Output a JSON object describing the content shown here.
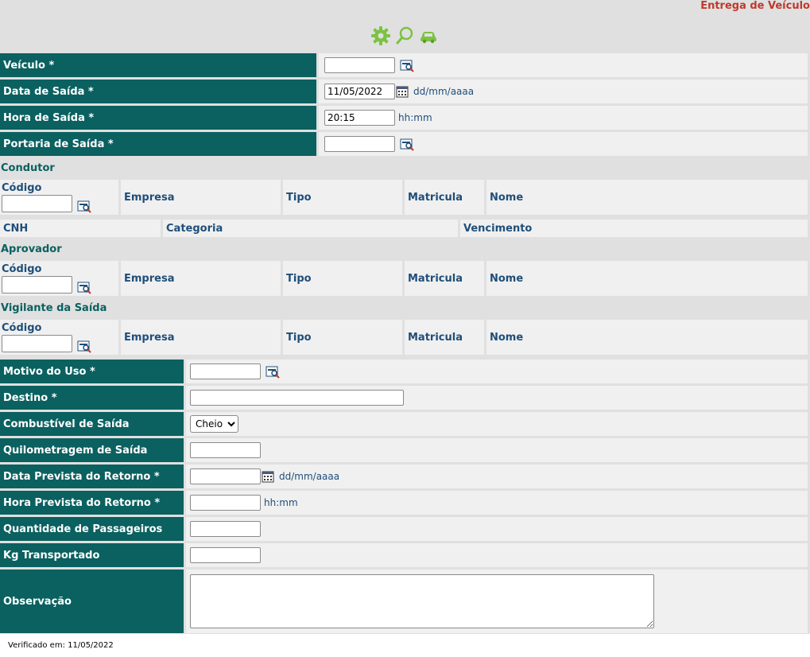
{
  "page_title": "Entrega de Veículo",
  "toolbar": {
    "icons": [
      "gear-icon",
      "search-icon",
      "car-icon"
    ]
  },
  "top_fields": {
    "veiculo": {
      "label": "Veículo *",
      "value": ""
    },
    "data_saida": {
      "label": "Data de Saída *",
      "value": "11/05/2022",
      "hint": "dd/mm/aaaa"
    },
    "hora_saida": {
      "label": "Hora de Saída *",
      "value": "20:15",
      "hint": "hh:mm"
    },
    "portaria_saida": {
      "label": "Portaria de Saída *",
      "value": ""
    }
  },
  "condutor": {
    "title": "Condutor",
    "codigo_label": "Código",
    "codigo_value": "",
    "empresa": "Empresa",
    "tipo": "Tipo",
    "matricula": "Matricula",
    "nome": "Nome",
    "cnh": "CNH",
    "categoria": "Categoria",
    "vencimento": "Vencimento"
  },
  "aprovador": {
    "title": "Aprovador",
    "codigo_label": "Código",
    "codigo_value": "",
    "empresa": "Empresa",
    "tipo": "Tipo",
    "matricula": "Matricula",
    "nome": "Nome"
  },
  "vigilante": {
    "title": "Vigilante da Saída",
    "codigo_label": "Código",
    "codigo_value": "",
    "empresa": "Empresa",
    "tipo": "Tipo",
    "matricula": "Matricula",
    "nome": "Nome"
  },
  "bottom_fields": {
    "motivo_uso": {
      "label": "Motivo do Uso *",
      "value": ""
    },
    "destino": {
      "label": "Destino *",
      "value": ""
    },
    "combustivel": {
      "label": "Combustível de Saída",
      "selected": "Cheio"
    },
    "quilometragem": {
      "label": "Quilometragem de Saída",
      "value": ""
    },
    "data_retorno": {
      "label": "Data Prevista do Retorno *",
      "value": "",
      "hint": "dd/mm/aaaa"
    },
    "hora_retorno": {
      "label": "Hora Prevista do Retorno *",
      "value": "",
      "hint": "hh:mm"
    },
    "passageiros": {
      "label": "Quantidade de Passageiros",
      "value": ""
    },
    "kg": {
      "label": "Kg Transportado",
      "value": ""
    },
    "observacao": {
      "label": "Observação",
      "value": ""
    }
  },
  "footer": {
    "text": "Verificado em: 11/05/2022"
  },
  "colors": {
    "label_bg": "#0b6060",
    "title_red": "#c0392b",
    "link_blue": "#1f4e79",
    "icon_green": "#7dc243"
  }
}
